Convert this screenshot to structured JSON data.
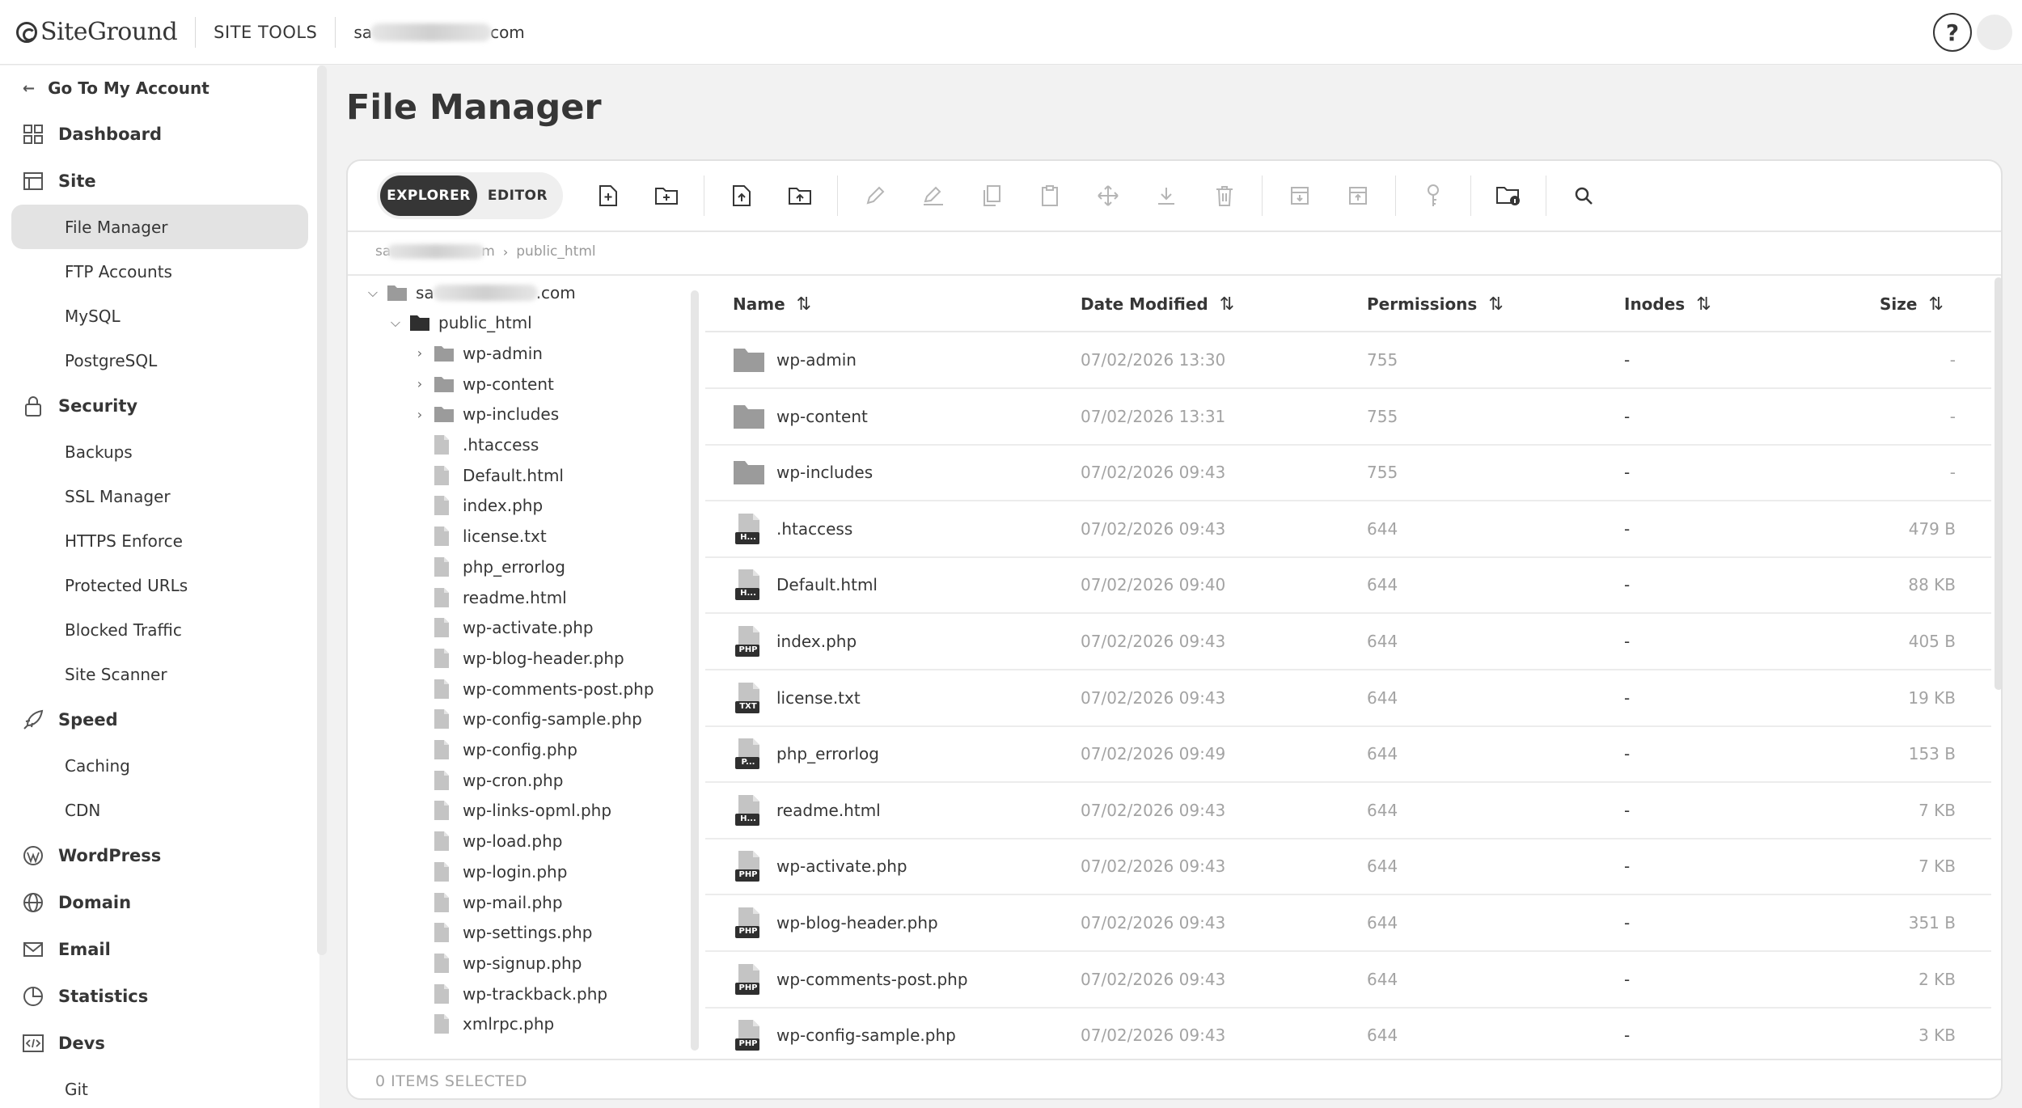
{
  "topbar": {
    "logo_text": "SiteGround",
    "site_tools_label": "SITE TOOLS",
    "domain_prefix": "sa",
    "domain_suffix": "com",
    "help_label": "?"
  },
  "sidebar": {
    "back_label": "Go To My Account",
    "sections": [
      {
        "label": "Dashboard",
        "icon": "dashboard-icon",
        "items": []
      },
      {
        "label": "Site",
        "icon": "site-icon",
        "items": [
          "File Manager",
          "FTP Accounts",
          "MySQL",
          "PostgreSQL"
        ]
      },
      {
        "label": "Security",
        "icon": "lock-icon",
        "items": [
          "Backups",
          "SSL Manager",
          "HTTPS Enforce",
          "Protected URLs",
          "Blocked Traffic",
          "Site Scanner"
        ]
      },
      {
        "label": "Speed",
        "icon": "rocket-icon",
        "items": [
          "Caching",
          "CDN"
        ]
      },
      {
        "label": "WordPress",
        "icon": "wordpress-icon",
        "items": []
      },
      {
        "label": "Domain",
        "icon": "globe-icon",
        "items": []
      },
      {
        "label": "Email",
        "icon": "mail-icon",
        "items": []
      },
      {
        "label": "Statistics",
        "icon": "pie-chart-icon",
        "items": []
      },
      {
        "label": "Devs",
        "icon": "code-icon",
        "items": [
          "Git"
        ]
      }
    ],
    "active_item": "File Manager"
  },
  "page": {
    "title": "File Manager"
  },
  "toolbar": {
    "explorer_label": "EXPLORER",
    "editor_label": "EDITOR"
  },
  "breadcrumb": {
    "root_prefix": "sa",
    "root_suffix": "m",
    "current": "public_html"
  },
  "tree": {
    "root_prefix": "sa",
    "root_suffix": ".com",
    "public_html": "public_html",
    "folders": [
      "wp-admin",
      "wp-content",
      "wp-includes"
    ],
    "files": [
      ".htaccess",
      "Default.html",
      "index.php",
      "license.txt",
      "php_errorlog",
      "readme.html",
      "wp-activate.php",
      "wp-blog-header.php",
      "wp-comments-post.php",
      "wp-config-sample.php",
      "wp-config.php",
      "wp-cron.php",
      "wp-links-opml.php",
      "wp-load.php",
      "wp-login.php",
      "wp-mail.php",
      "wp-settings.php",
      "wp-signup.php",
      "wp-trackback.php",
      "xmlrpc.php"
    ]
  },
  "list": {
    "headers": {
      "name": "Name",
      "date": "Date Modified",
      "permissions": "Permissions",
      "inodes": "Inodes",
      "size": "Size"
    },
    "rows": [
      {
        "name": "wp-admin",
        "type": "folder",
        "badge": "",
        "date": "07/02/2026 13:30",
        "permissions": "755",
        "inodes": "-",
        "size": "-"
      },
      {
        "name": "wp-content",
        "type": "folder",
        "badge": "",
        "date": "07/02/2026 13:31",
        "permissions": "755",
        "inodes": "-",
        "size": "-"
      },
      {
        "name": "wp-includes",
        "type": "folder",
        "badge": "",
        "date": "07/02/2026 09:43",
        "permissions": "755",
        "inodes": "-",
        "size": "-"
      },
      {
        "name": ".htaccess",
        "type": "file",
        "badge": "H...",
        "date": "07/02/2026 09:43",
        "permissions": "644",
        "inodes": "-",
        "size": "479 B"
      },
      {
        "name": "Default.html",
        "type": "file",
        "badge": "H...",
        "date": "07/02/2026 09:40",
        "permissions": "644",
        "inodes": "-",
        "size": "88 KB"
      },
      {
        "name": "index.php",
        "type": "file",
        "badge": "PHP",
        "date": "07/02/2026 09:43",
        "permissions": "644",
        "inodes": "-",
        "size": "405 B"
      },
      {
        "name": "license.txt",
        "type": "file",
        "badge": "TXT",
        "date": "07/02/2026 09:43",
        "permissions": "644",
        "inodes": "-",
        "size": "19 KB"
      },
      {
        "name": "php_errorlog",
        "type": "file",
        "badge": "P...",
        "date": "07/02/2026 09:49",
        "permissions": "644",
        "inodes": "-",
        "size": "153 B"
      },
      {
        "name": "readme.html",
        "type": "file",
        "badge": "H...",
        "date": "07/02/2026 09:43",
        "permissions": "644",
        "inodes": "-",
        "size": "7 KB"
      },
      {
        "name": "wp-activate.php",
        "type": "file",
        "badge": "PHP",
        "date": "07/02/2026 09:43",
        "permissions": "644",
        "inodes": "-",
        "size": "7 KB"
      },
      {
        "name": "wp-blog-header.php",
        "type": "file",
        "badge": "PHP",
        "date": "07/02/2026 09:43",
        "permissions": "644",
        "inodes": "-",
        "size": "351 B"
      },
      {
        "name": "wp-comments-post.php",
        "type": "file",
        "badge": "PHP",
        "date": "07/02/2026 09:43",
        "permissions": "644",
        "inodes": "-",
        "size": "2 KB"
      },
      {
        "name": "wp-config-sample.php",
        "type": "file",
        "badge": "PHP",
        "date": "07/02/2026 09:43",
        "permissions": "644",
        "inodes": "-",
        "size": "3 KB"
      }
    ]
  },
  "footer": {
    "selection_label": "0 ITEMS SELECTED"
  },
  "colors": {
    "dark": "#363636",
    "muted": "#a3a3a3",
    "active_bg": "#e3e3e3",
    "folder": "#9b9b9b",
    "file": "#c4c4c4"
  }
}
